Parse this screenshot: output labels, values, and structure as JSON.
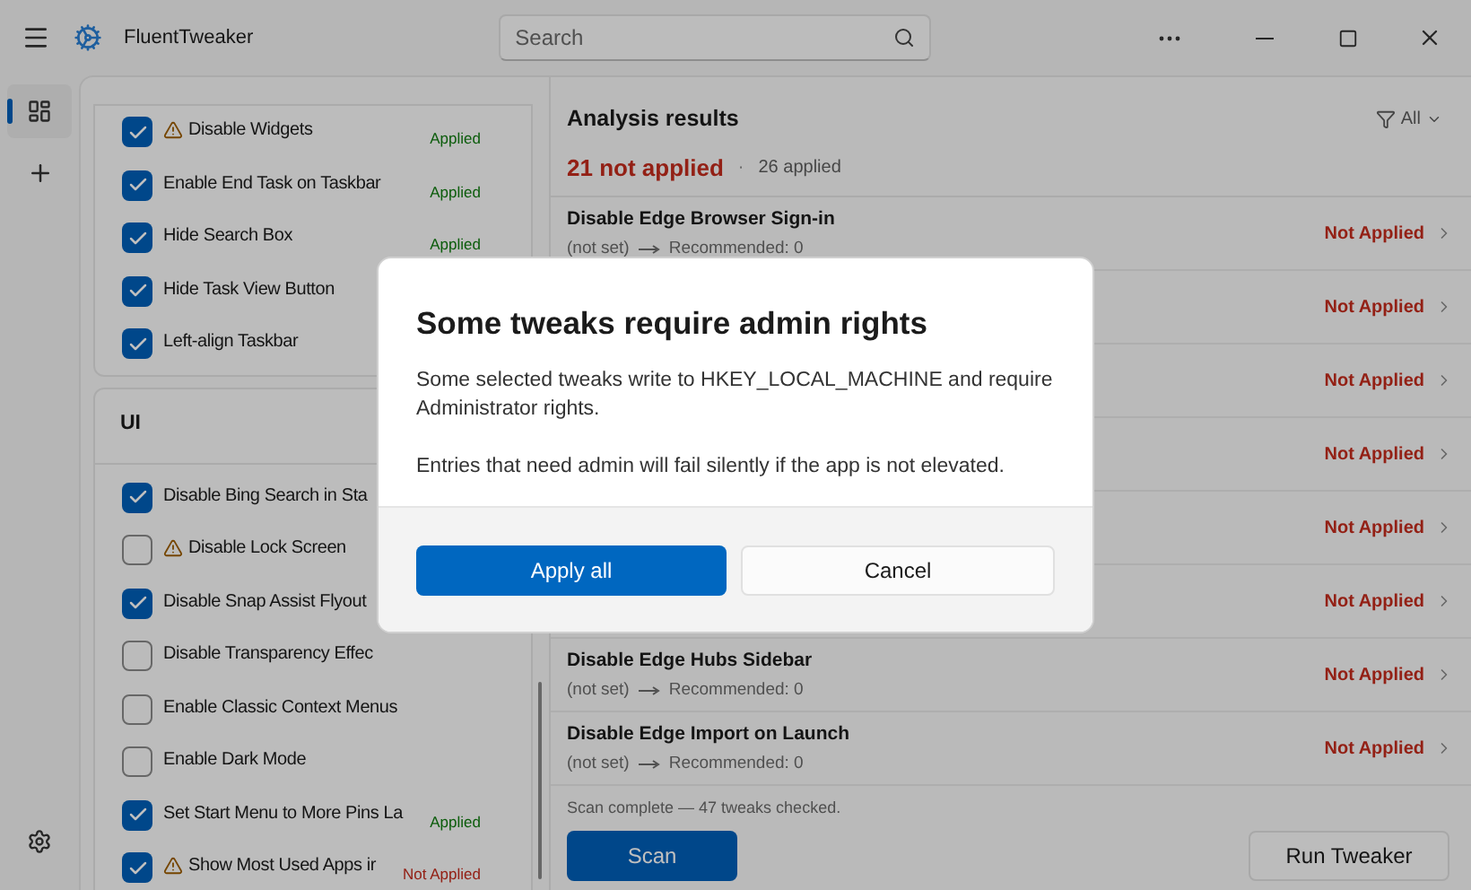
{
  "window": {
    "title": "FluentTweaker"
  },
  "search": {
    "placeholder": "Search"
  },
  "nav": [
    {
      "selected": true
    },
    {
      "selected": false
    }
  ],
  "groups": [
    {
      "items": [
        {
          "label": "Disable Widgets",
          "checked": true,
          "warning": true,
          "status": "Applied",
          "applied": true
        },
        {
          "label": "Enable End Task on Taskbar",
          "checked": true,
          "warning": false,
          "status": "Applied",
          "applied": true
        },
        {
          "label": "Hide Search Box",
          "checked": true,
          "warning": false,
          "status": "Applied",
          "applied": true
        },
        {
          "label": "Hide Task View Button",
          "checked": true,
          "warning": false
        },
        {
          "label": "Left-align Taskbar",
          "checked": true,
          "warning": false
        }
      ]
    },
    {
      "title": "UI",
      "items": [
        {
          "label": "Disable Bing Search in Sta",
          "checked": true,
          "warning": false
        },
        {
          "label": "Disable Lock Screen",
          "checked": false,
          "warning": true
        },
        {
          "label": "Disable Snap Assist Flyout",
          "checked": true,
          "warning": false
        },
        {
          "label": "Disable Transparency Effec",
          "checked": false,
          "warning": false
        },
        {
          "label": "Enable Classic Context Menus",
          "checked": false,
          "warning": false
        },
        {
          "label": "Enable Dark Mode",
          "checked": false,
          "warning": false
        },
        {
          "label": "Set Start Menu to More Pins La",
          "checked": true,
          "warning": false,
          "status": "Applied",
          "applied": true
        },
        {
          "label": "Show Most Used Apps ir",
          "checked": true,
          "warning": true,
          "status": "Not Applied",
          "applied": false
        }
      ]
    }
  ],
  "results": {
    "title": "Analysis results",
    "filter": "All",
    "not_applied": "21 not applied",
    "separator": "·",
    "applied": "26 applied",
    "rows": [
      {
        "name": "Disable Edge Browser Sign-in",
        "current": "(not set)",
        "recommended": "Recommended: 0",
        "status": "Not Applied"
      },
      {
        "status": "Not Applied"
      },
      {
        "status": "Not Applied"
      },
      {
        "status": "Not Applied"
      },
      {
        "status": "Not Applied"
      },
      {
        "status": "Not Applied"
      },
      {
        "name": "Disable Edge Hubs Sidebar",
        "current": "(not set)",
        "recommended": "Recommended: 0",
        "status": "Not Applied"
      },
      {
        "name": "Disable Edge Import on Launch",
        "current": "(not set)",
        "recommended": "Recommended: 0",
        "status": "Not Applied"
      }
    ],
    "summary": "Scan complete — 47 tweaks checked.",
    "buttons": [
      {
        "label": "Scan",
        "kind": "primary"
      },
      {
        "label": "Run Tweaker",
        "kind": "secondary"
      }
    ]
  },
  "dialog": {
    "title": "Some tweaks require admin rights",
    "paragraphs": [
      "Some selected tweaks write to HKEY_LOCAL_MACHINE and require Administrator rights.",
      "Entries that need admin will fail silently if the app is not elevated."
    ],
    "buttons": [
      {
        "label": "Apply all",
        "kind": "primary"
      },
      {
        "label": "Cancel",
        "kind": "secondary"
      }
    ]
  }
}
